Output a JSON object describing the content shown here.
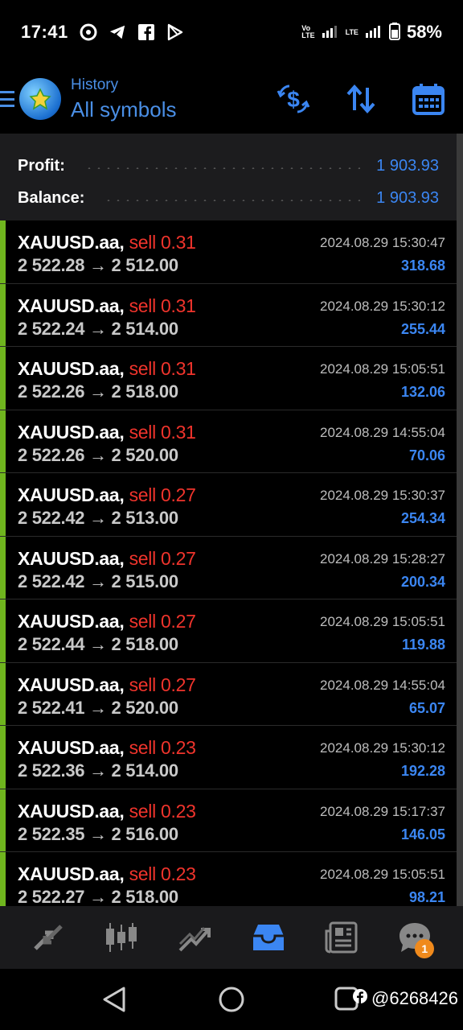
{
  "status_bar": {
    "time": "17:41",
    "left_icons": [
      "vpn-icon",
      "telegram-icon",
      "facebook-icon",
      "play-store-icon"
    ],
    "volte_label": "Vo\nLTE",
    "lte_label": "LTE",
    "battery_percent": "58%"
  },
  "header": {
    "subtitle": "History",
    "title": "All symbols",
    "actions": [
      "currency-exchange-icon",
      "sort-icon",
      "calendar-icon"
    ]
  },
  "summary": {
    "profit_label": "Profit:",
    "profit_value": "1 903.93",
    "balance_label": "Balance:",
    "balance_value": "1 903.93"
  },
  "deals": [
    {
      "symbol": "XAUUSD.aa,",
      "type": "sell 0.31",
      "prices": "2 522.28 → 2 512.00",
      "time": "2024.08.29 15:30:47",
      "profit": "318.68"
    },
    {
      "symbol": "XAUUSD.aa,",
      "type": "sell 0.31",
      "prices": "2 522.24 → 2 514.00",
      "time": "2024.08.29 15:30:12",
      "profit": "255.44"
    },
    {
      "symbol": "XAUUSD.aa,",
      "type": "sell 0.31",
      "prices": "2 522.26 → 2 518.00",
      "time": "2024.08.29 15:05:51",
      "profit": "132.06"
    },
    {
      "symbol": "XAUUSD.aa,",
      "type": "sell 0.31",
      "prices": "2 522.26 → 2 520.00",
      "time": "2024.08.29 14:55:04",
      "profit": "70.06"
    },
    {
      "symbol": "XAUUSD.aa,",
      "type": "sell 0.27",
      "prices": "2 522.42 → 2 513.00",
      "time": "2024.08.29 15:30:37",
      "profit": "254.34"
    },
    {
      "symbol": "XAUUSD.aa,",
      "type": "sell 0.27",
      "prices": "2 522.42 → 2 515.00",
      "time": "2024.08.29 15:28:27",
      "profit": "200.34"
    },
    {
      "symbol": "XAUUSD.aa,",
      "type": "sell 0.27",
      "prices": "2 522.44 → 2 518.00",
      "time": "2024.08.29 15:05:51",
      "profit": "119.88"
    },
    {
      "symbol": "XAUUSD.aa,",
      "type": "sell 0.27",
      "prices": "2 522.41 → 2 520.00",
      "time": "2024.08.29 14:55:04",
      "profit": "65.07"
    },
    {
      "symbol": "XAUUSD.aa,",
      "type": "sell 0.23",
      "prices": "2 522.36 → 2 514.00",
      "time": "2024.08.29 15:30:12",
      "profit": "192.28"
    },
    {
      "symbol": "XAUUSD.aa,",
      "type": "sell 0.23",
      "prices": "2 522.35 → 2 516.00",
      "time": "2024.08.29 15:17:37",
      "profit": "146.05"
    },
    {
      "symbol": "XAUUSD.aa,",
      "type": "sell 0.23",
      "prices": "2 522.27 → 2 518.00",
      "time": "2024.08.29 15:05:51",
      "profit": "98.21"
    }
  ],
  "tabbar": {
    "tabs": [
      "quotes-icon",
      "chart-candles-icon",
      "trade-icon",
      "history-inbox-icon",
      "news-icon",
      "chat-icon"
    ],
    "active_tab": "history-inbox-icon",
    "chat_badge": "1"
  },
  "system_nav": [
    "back-icon",
    "home-icon",
    "recents-icon"
  ],
  "watermark": "@6268426",
  "colors": {
    "accent": "#3b86f2",
    "sell": "#f0342c",
    "deal_marker": "#6fb51e",
    "badge": "#f08a1c"
  }
}
